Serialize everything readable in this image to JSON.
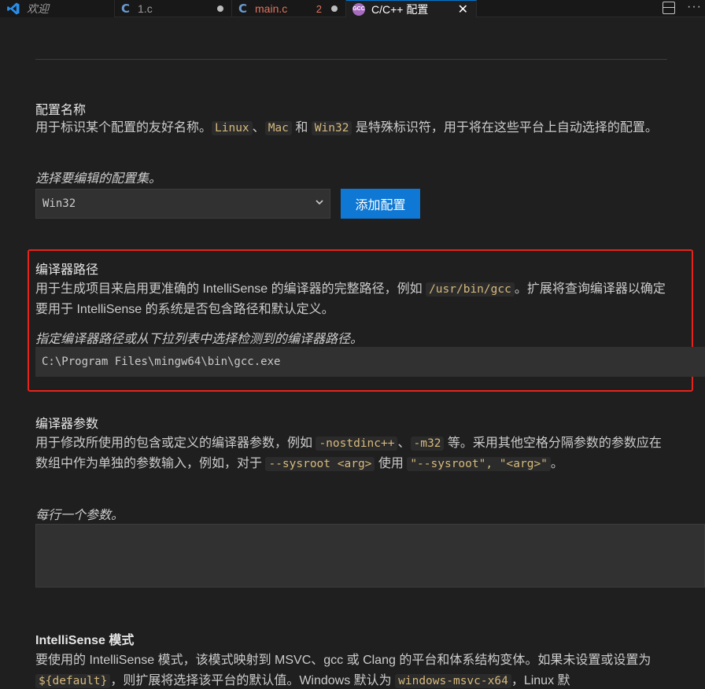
{
  "tabs": [
    {
      "label": "欢迎"
    },
    {
      "label": "1.c"
    },
    {
      "label": "main.c",
      "problems": "2"
    },
    {
      "label": "C/C++ 配置"
    }
  ],
  "config_name": {
    "title": "配置名称",
    "desc_part1": "用于标识某个配置的友好名称。",
    "code1": "Linux",
    "sep1": "、",
    "code2": "Mac",
    "sep2": " 和 ",
    "code3": "Win32",
    "desc_part2": " 是特殊标识符，用于将在这些平台上自动选择的配置。",
    "hint": "选择要编辑的配置集。",
    "selected": "Win32",
    "add_button": "添加配置"
  },
  "compiler_path": {
    "title": "编译器路径",
    "desc_part1": "用于生成项目来启用更准确的 IntelliSense 的编译器的完整路径，例如 ",
    "code1": "/usr/bin/gcc",
    "desc_part2": "。扩展将查询编译器以确定要用于 IntelliSense 的系统是否包含路径和默认定义。",
    "hint": "指定编译器路径或从下拉列表中选择检测到的编译器路径。",
    "value": "C:\\Program Files\\mingw64\\bin\\gcc.exe"
  },
  "compiler_args": {
    "title": "编译器参数",
    "desc_part1": "用于修改所使用的包含或定义的编译器参数，例如 ",
    "code1": "-nostdinc++",
    "sep1": "、",
    "code2": "-m32",
    "desc_part2": " 等。采用其他空格分隔参数的参数应在数组中作为单独的参数输入，例如，对于 ",
    "code3": "--sysroot <arg>",
    "desc_part3": " 使用 ",
    "code4": "\"--sysroot\", \"<arg>\"",
    "desc_part4": "。",
    "hint": "每行一个参数。"
  },
  "intellisense_mode": {
    "title": "IntelliSense 模式",
    "desc_part1": "要使用的 IntelliSense 模式，该模式映射到 MSVC、gcc 或 Clang 的平台和体系结构变体。如果未设置或设置为 ",
    "code1": "${default}",
    "desc_part2": "，则扩展将选择该平台的默认值。Windows 默认为 ",
    "code2": "windows-msvc-x64",
    "desc_part3": "，Linux 默"
  },
  "colors": {
    "accent": "#0e78d4",
    "highlight": "#e5241c",
    "code_text": "#d7ba7d"
  }
}
